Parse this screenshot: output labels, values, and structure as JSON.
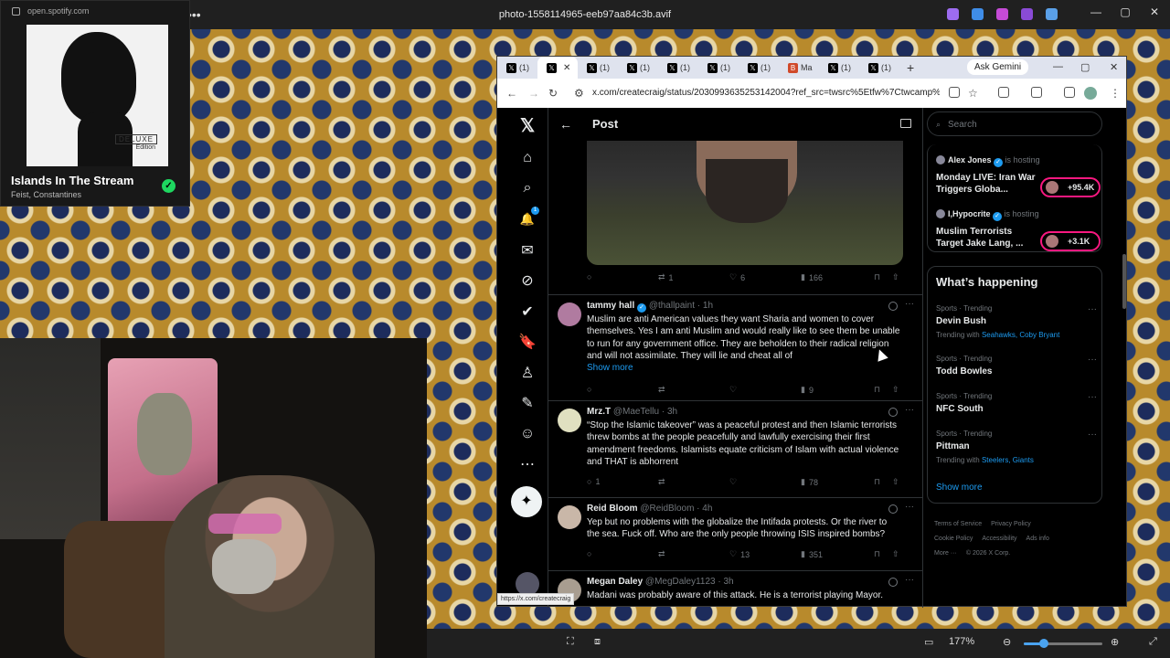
{
  "viewer": {
    "title": "photo-1558114965-eeb97aa84c3b.avif",
    "more_glyph": "•••",
    "min_glyph": "—",
    "max_glyph": "▢",
    "close_glyph": "✕",
    "zoom": "177%",
    "zoom_fraction": 0.25,
    "zoom_out_glyph": "⊖",
    "zoom_in_glyph": "⊕",
    "app_colors": [
      "#9d6cf0",
      "#3f8de8",
      "#c54bd6",
      "#8a4bd6",
      "#5aa0e8"
    ]
  },
  "spotify": {
    "url": "open.spotify.com",
    "album_badge": "DELUXE",
    "album_edition": "Edition",
    "track": "Islands In The Stream",
    "artist": "Feist, Constantines",
    "check_glyph": "✓"
  },
  "browser": {
    "tab_label": "(1)",
    "tab_icon": "𝕏",
    "tab_letter_b": "B",
    "tab_label_b": "Ma",
    "close_glyph": "✕",
    "new_tab": "+",
    "gemini": "Ask Gemini",
    "url": "x.com/createcraig/status/2030993635253142004?ref_src=twsrc%5Etfw%7Ctwcamp%5Etwe...",
    "status_url": "https://x.com/createcraig",
    "back_glyph": "←",
    "forward_glyph": "→",
    "reload_glyph": "↻"
  },
  "x": {
    "logo": "𝕏",
    "nav_icons": [
      "⌂",
      "⌕",
      "🔔",
      "✉",
      "⊘",
      "✔",
      "🔖",
      "♙",
      "✎",
      "☺",
      "⋯"
    ],
    "notification_count": "1",
    "post_glyph": "✦",
    "header_title": "Post",
    "back_glyph": "←",
    "first_stats": {
      "reply": "",
      "repost": "1",
      "like": "6",
      "views": "166"
    },
    "reply_glyph": "○",
    "repost_glyph": "⇄",
    "like_glyph": "♡",
    "views_glyph": "▮",
    "bookmark_glyph": "⊓",
    "share_glyph": "⇧",
    "more_glyph": "···",
    "tweets": [
      {
        "name": "tammy hall",
        "verified": true,
        "handle": "@thallpaint · 1h",
        "text": "Muslim are anti American values they want Sharia and women to cover themselves. Yes I am anti Muslim and would really like to see them be unable to run for any government office. They are beholden to their radical religion and will not assimilate. They will lie and cheat all of",
        "show_more": "Show more",
        "reply": "",
        "repost": "",
        "like": "",
        "views": "9",
        "avatar_color": "#b07ba0"
      },
      {
        "name": "Mrz.T",
        "verified": false,
        "handle": "@MaeTellu · 3h",
        "text": "“Stop the Islamic takeover” was a peaceful protest and then Islamic terrorists threw bombs at the people peacefully and lawfully exercising their first amendment freedoms. Islamists equate criticism of Islam with actual violence and THAT is abhorrent",
        "reply": "1",
        "repost": "",
        "like": "",
        "views": "78",
        "avatar_color": "#e0e0c0"
      },
      {
        "name": "Reid Bloom",
        "verified": false,
        "handle": "@ReidBloom · 4h",
        "text": "Yep but no problems with the globalize the Intifada protests. Or the river to the sea. Fuck off. Who are the only people throwing ISIS inspired bombs?",
        "reply": "",
        "repost": "",
        "like": "13",
        "views": "351",
        "avatar_color": "#c9b7a8"
      },
      {
        "name": "Megan Daley",
        "verified": false,
        "handle": "@MegDaley1123 · 3h",
        "text": "Madani was probably aware of this attack. He is a terrorist playing Mayor.",
        "avatar_color": "#a89d90"
      }
    ],
    "search_placeholder": "Search",
    "search_glyph": "⌕",
    "spaces": [
      {
        "host": "Alex Jones",
        "hosting": "is hosting",
        "title": "Monday LIVE: Iran War Triggers Globa...",
        "listeners": "+95.4K"
      },
      {
        "host": "I,Hypocrite",
        "hosting": "is hosting",
        "title": "Muslim Terrorists Target Jake Lang, ...",
        "listeners": "+3.1K"
      }
    ],
    "happening_title": "What’s happening",
    "trends": [
      {
        "category": "Sports · Trending",
        "name": "Devin Bush",
        "with_label": "Trending with",
        "with": "Seahawks, Coby Bryant"
      },
      {
        "category": "Sports · Trending",
        "name": "Todd Bowles",
        "with_label": "",
        "with": ""
      },
      {
        "category": "Sports · Trending",
        "name": "NFC South",
        "with_label": "",
        "with": ""
      },
      {
        "category": "Sports · Trending",
        "name": "Pittman",
        "with_label": "Trending with",
        "with": "Steelers, Giants"
      }
    ],
    "show_more": "Show more",
    "footer": [
      "Terms of Service",
      "Privacy Policy",
      "Cookie Policy",
      "Accessibility",
      "Ads info",
      "More ···",
      "© 2026 X Corp."
    ]
  }
}
